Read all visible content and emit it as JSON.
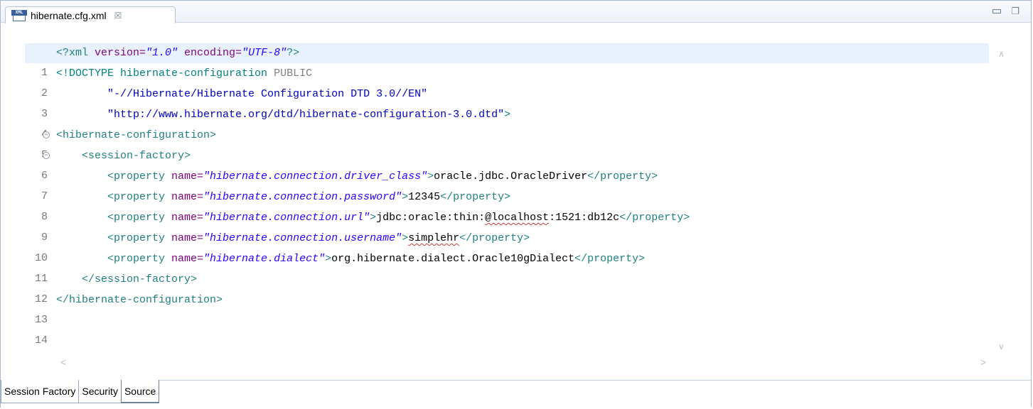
{
  "editor_tab": {
    "icon": "xml-file-icon",
    "title": "hibernate.cfg.xml",
    "close_glyph": "☒"
  },
  "window_controls": {
    "minimize": "minimize-icon",
    "restore": "restore-icon"
  },
  "code": {
    "line_numbers": [
      "1",
      "2",
      "3",
      "4",
      "5",
      "6",
      "7",
      "8",
      "9",
      "10",
      "11",
      "12",
      "13",
      "14"
    ],
    "lines": [
      "<?xml version=\"1.0\" encoding=\"UTF-8\"?>",
      "<!DOCTYPE hibernate-configuration PUBLIC",
      "        \"-//Hibernate/Hibernate Configuration DTD 3.0//EN\"",
      "        \"http://www.hibernate.org/dtd/hibernate-configuration-3.0.dtd\">",
      "<hibernate-configuration>",
      "    <session-factory>",
      "        <property name=\"hibernate.connection.driver_class\">oracle.jdbc.OracleDriver</property>",
      "        <property name=\"hibernate.connection.password\">12345</property>",
      "        <property name=\"hibernate.connection.url\">jdbc:oracle:thin:@localhost:1521:db12c</property>",
      "        <property name=\"hibernate.connection.username\">simplehr</property>",
      "        <property name=\"hibernate.dialect\">org.hibernate.dialect.Oracle10gDialect</property>",
      "    </session-factory>",
      "</hibernate-configuration>",
      ""
    ]
  },
  "tokens": {
    "xml_decl_open": "<?xml ",
    "version_attr": "version=",
    "version_val": "\"1.0\"",
    "encoding_attr": " encoding=",
    "encoding_val": "\"UTF-8\"",
    "xml_decl_close": "?>",
    "doctype_open": "<!DOCTYPE hibernate-configuration ",
    "doctype_public": "PUBLIC",
    "dtd_public_id": "\"-//Hibernate/Hibernate Configuration DTD 3.0//EN\"",
    "dtd_system_id": "\"http://www.hibernate.org/dtd/hibernate-configuration-3.0.dtd\"",
    "doctype_close": ">",
    "hc_open": "<hibernate-configuration>",
    "sf_open": "<session-factory>",
    "prop_open": "<property ",
    "name_attr": "name=",
    "prop_tag_close": ">",
    "prop_close": "</property>",
    "p1_name": "\"hibernate.connection.driver_class\"",
    "p1_value": "oracle.jdbc.OracleDriver",
    "p2_name": "\"hibernate.connection.password\"",
    "p2_value": "12345",
    "p3_name": "\"hibernate.connection.url\"",
    "p3_value_a": "jdbc:oracle:thin:",
    "p3_value_b": "@localhost",
    "p3_value_c": ":1521:db12c",
    "p4_name": "\"hibernate.connection.username\"",
    "p4_value": "simplehr",
    "p5_name": "\"hibernate.dialect\"",
    "p5_value": "org.hibernate.dialect.Oracle10gDialect",
    "sf_close": "</session-factory>",
    "hc_close": "</hibernate-configuration>"
  },
  "page_tabs": [
    {
      "label": "Session Factory"
    },
    {
      "label": "Security"
    },
    {
      "label": "Source",
      "active": true
    }
  ],
  "colors": {
    "tag": "#1f7f80",
    "attribute": "#7f007f",
    "attribute_value": "#2a00ff",
    "current_line": "#e8f2fe"
  }
}
